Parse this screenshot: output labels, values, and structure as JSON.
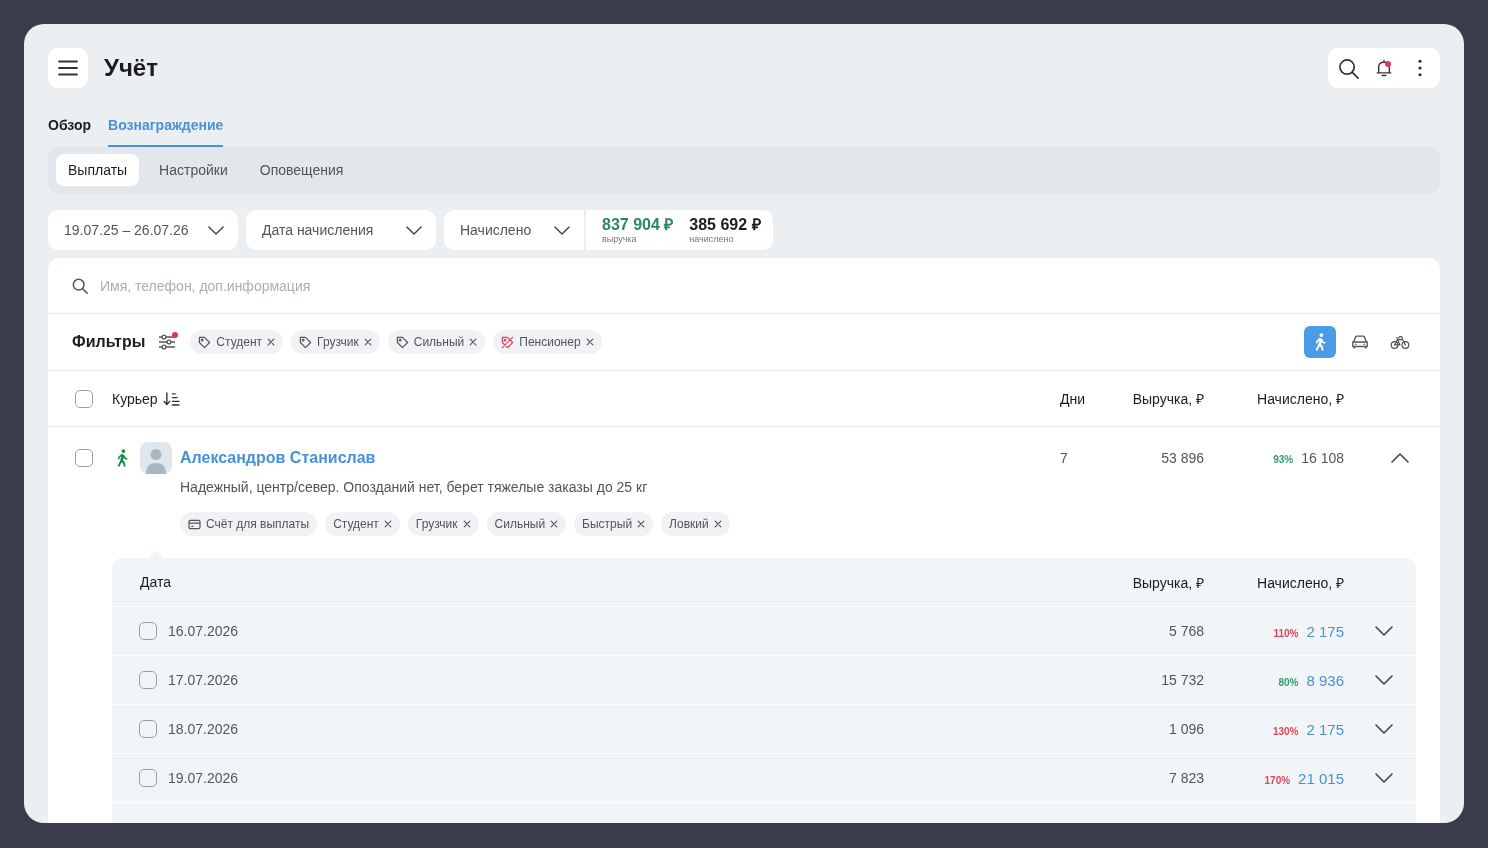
{
  "header": {
    "title": "Учёт",
    "notifications_unread": true
  },
  "tabs": [
    {
      "label": "Обзор",
      "selected": false
    },
    {
      "label": "Вознаграждение",
      "selected": true
    }
  ],
  "subtabs": [
    {
      "label": "Выплаты",
      "selected": true
    },
    {
      "label": "Настройки",
      "selected": false
    },
    {
      "label": "Оповещения",
      "selected": false
    }
  ],
  "toolbar": {
    "dropdowns": [
      {
        "value": "19.07.25 – 26.07.26"
      },
      {
        "value": "Дата начисления"
      },
      {
        "value": "Начислено"
      }
    ],
    "totals": [
      {
        "kind": "revenue",
        "value": "837 904 ₽",
        "caption": "выручка"
      },
      {
        "kind": "accrued",
        "value": "385 692 ₽",
        "caption": "начислено"
      }
    ]
  },
  "search": {
    "placeholder": "Имя, телефон, доп.информация"
  },
  "filters": {
    "label": "Фильтры",
    "has_active": true,
    "tags": [
      {
        "label": "Студент",
        "excluded": false
      },
      {
        "label": "Грузчик",
        "excluded": false
      },
      {
        "label": "Сильный",
        "excluded": false
      },
      {
        "label": "Пенсионер",
        "excluded": true
      }
    ],
    "transport": [
      {
        "kind": "walk",
        "selected": true
      },
      {
        "kind": "car",
        "selected": false
      },
      {
        "kind": "bike",
        "selected": false
      }
    ]
  },
  "table": {
    "all_checked": false,
    "columns": [
      {
        "label": "Курьер",
        "sorted": true
      },
      {
        "label": "Дни"
      },
      {
        "label": "Выручка, ₽"
      },
      {
        "label": "Начислено, ₽"
      }
    ],
    "couriers": [
      {
        "kind": "walk",
        "checked": false,
        "name": "Александров Станислав",
        "note": "Надежный, центр/север. Опозданий нет, берет тяжелые заказы до 25 кг",
        "tags": [
          {
            "kind": "account",
            "label": "Счёт для выплаты"
          },
          {
            "kind": "tag",
            "label": "Студент"
          },
          {
            "kind": "tag",
            "label": "Грузчик"
          },
          {
            "kind": "tag",
            "label": "Сильный"
          },
          {
            "kind": "tag",
            "label": "Быстрый"
          },
          {
            "kind": "tag",
            "label": "Ловкий"
          }
        ],
        "days": "7",
        "revenue": "53 896",
        "share": {
          "text": "93%",
          "color": "#2f9e6f"
        },
        "accrued": "16 108",
        "expanded": true,
        "details": {
          "columns": [
            "Дата",
            "Выручка, ₽",
            "Начислено, ₽"
          ],
          "rows": [
            {
              "checked": false,
              "date": "16.07.2026",
              "revenue": "5 768",
              "share": {
                "text": "110%",
                "color": "#e0445a"
              },
              "accrued": "2 175",
              "expanded": false
            },
            {
              "checked": false,
              "date": "17.07.2026",
              "revenue": "15 732",
              "share": {
                "text": "80%",
                "color": "#2f9e6f"
              },
              "accrued": "8 936",
              "expanded": false
            },
            {
              "checked": false,
              "date": "18.07.2026",
              "revenue": "1 096",
              "share": {
                "text": "130%",
                "color": "#e0445a"
              },
              "accrued": "2 175",
              "expanded": false
            },
            {
              "checked": false,
              "date": "19.07.2026",
              "revenue": "7 823",
              "share": {
                "text": "170%",
                "color": "#e0445a"
              },
              "accrued": "21 015",
              "expanded": false
            }
          ]
        }
      }
    ]
  }
}
